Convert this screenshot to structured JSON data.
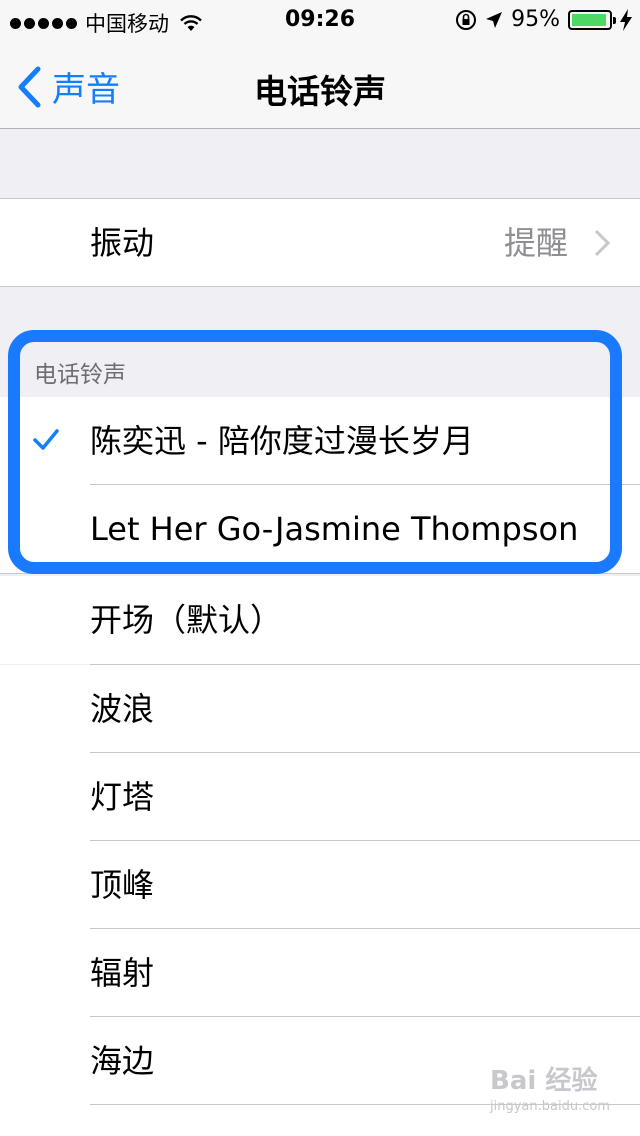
{
  "status_bar": {
    "carrier": "中国移动",
    "time": "09:26",
    "battery": "95%",
    "battery_level": 0.95,
    "battery_color": "#4cd964"
  },
  "nav": {
    "back_label": "声音",
    "title": "电话铃声",
    "accent": "#147efb"
  },
  "vibration": {
    "label": "振动",
    "value": "提醒"
  },
  "section_header": "电话铃声",
  "ringtones_custom": [
    {
      "label": "陈奕迅 - 陪你度过漫长岁月",
      "selected": true
    },
    {
      "label": "Let Her Go-Jasmine Thompson",
      "selected": false
    }
  ],
  "ringtones_builtin": [
    {
      "label": "开场（默认）"
    },
    {
      "label": "波浪"
    },
    {
      "label": "灯塔"
    },
    {
      "label": "顶峰"
    },
    {
      "label": "辐射"
    },
    {
      "label": "海边"
    }
  ],
  "watermark": {
    "brand": "Bai 经验",
    "url": "jingyan.baidu.com"
  },
  "highlight_color": "#1a7aff"
}
